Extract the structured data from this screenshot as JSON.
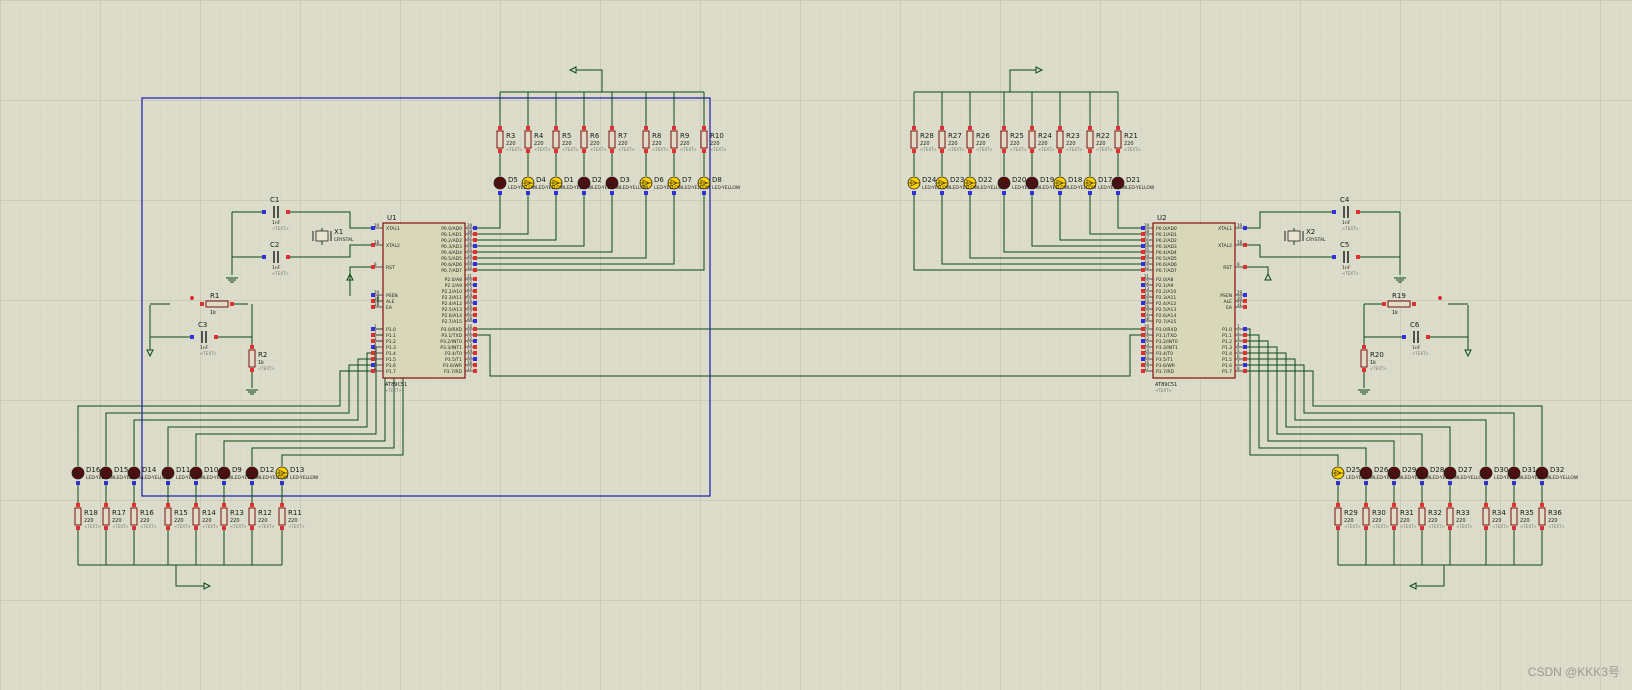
{
  "watermark": "CSDN @KKK3号",
  "colors": {
    "background": "#dcdccb",
    "grid_minor": "#cfcfbc",
    "grid_major": "#c0c0ac",
    "wire": "#0a4a14",
    "frame": "#1a1ab0",
    "chip_fill": "#d8d8b8",
    "chip_stroke": "#8a0a0a",
    "led_off": "#5a0a0a",
    "led_on": "#ffd200",
    "pin_red": "#e03030",
    "pin_blue": "#3030e0"
  },
  "u1": {
    "ref": "U1",
    "part": "AT89C51",
    "text": "<TEXT>",
    "left_pins": [
      {
        "num": "19",
        "name": "XTAL1"
      },
      {
        "num": "18",
        "name": "XTAL2"
      },
      {
        "num": "9",
        "name": "RST"
      },
      {
        "num": "29",
        "name": "PSEN"
      },
      {
        "num": "30",
        "name": "ALE"
      },
      {
        "num": "31",
        "name": "EA"
      },
      {
        "num": "1",
        "name": "P1.0"
      },
      {
        "num": "2",
        "name": "P1.1"
      },
      {
        "num": "3",
        "name": "P1.2"
      },
      {
        "num": "4",
        "name": "P1.3"
      },
      {
        "num": "5",
        "name": "P1.4"
      },
      {
        "num": "6",
        "name": "P1.5"
      },
      {
        "num": "7",
        "name": "P1.6"
      },
      {
        "num": "8",
        "name": "P1.7"
      }
    ],
    "right_pins": [
      {
        "num": "39",
        "name": "P0.0/AD0"
      },
      {
        "num": "38",
        "name": "P0.1/AD1"
      },
      {
        "num": "37",
        "name": "P0.2/AD2"
      },
      {
        "num": "36",
        "name": "P0.3/AD3"
      },
      {
        "num": "35",
        "name": "P0.4/AD4"
      },
      {
        "num": "34",
        "name": "P0.5/AD5"
      },
      {
        "num": "33",
        "name": "P0.6/AD6"
      },
      {
        "num": "32",
        "name": "P0.7/AD7"
      },
      {
        "num": "21",
        "name": "P2.0/A8"
      },
      {
        "num": "22",
        "name": "P2.1/A9"
      },
      {
        "num": "23",
        "name": "P2.2/A10"
      },
      {
        "num": "24",
        "name": "P2.3/A11"
      },
      {
        "num": "25",
        "name": "P2.4/A12"
      },
      {
        "num": "26",
        "name": "P2.5/A13"
      },
      {
        "num": "27",
        "name": "P2.6/A14"
      },
      {
        "num": "28",
        "name": "P2.7/A15"
      },
      {
        "num": "10",
        "name": "P3.0/RXD"
      },
      {
        "num": "11",
        "name": "P3.1/TXD"
      },
      {
        "num": "12",
        "name": "P3.2/INT0"
      },
      {
        "num": "13",
        "name": "P3.3/INT1"
      },
      {
        "num": "14",
        "name": "P3.4/T0"
      },
      {
        "num": "15",
        "name": "P3.5/T1"
      },
      {
        "num": "16",
        "name": "P3.6/WR"
      },
      {
        "num": "17",
        "name": "P3.7/RD"
      }
    ]
  },
  "u2": {
    "ref": "U2",
    "part": "AT89C51",
    "text": "<TEXT>"
  },
  "passives": {
    "c1": {
      "ref": "C1",
      "val": "1nF"
    },
    "c2": {
      "ref": "C2",
      "val": "1nF"
    },
    "c3": {
      "ref": "C3",
      "val": "1nF"
    },
    "c4": {
      "ref": "C4",
      "val": "1nF"
    },
    "c5": {
      "ref": "C5",
      "val": "1nF"
    },
    "c6": {
      "ref": "C6",
      "val": "1nF"
    },
    "x1": {
      "ref": "X1",
      "val": "CRYSTAL"
    },
    "x2": {
      "ref": "X2",
      "val": "CRYSTAL"
    },
    "r1": {
      "ref": "R1",
      "val": "1k"
    },
    "r2": {
      "ref": "R2",
      "val": "1k"
    },
    "r19": {
      "ref": "R19",
      "val": "1k"
    },
    "r20": {
      "ref": "R20",
      "val": "1k"
    },
    "text": "<TEXT>"
  },
  "top_left_leds": [
    {
      "d": "D5",
      "r": "R3",
      "on": false
    },
    {
      "d": "D4",
      "r": "R4",
      "on": true
    },
    {
      "d": "D1",
      "r": "R5",
      "on": true
    },
    {
      "d": "D2",
      "r": "R6",
      "on": false
    },
    {
      "d": "D3",
      "r": "R7",
      "on": false
    },
    {
      "d": "D6",
      "r": "R8",
      "on": true
    },
    {
      "d": "D7",
      "r": "R9",
      "on": true
    },
    {
      "d": "D8",
      "r": "R10",
      "on": true
    }
  ],
  "top_right_leds": [
    {
      "d": "D24",
      "r": "R28",
      "on": true
    },
    {
      "d": "D23",
      "r": "R27",
      "on": true
    },
    {
      "d": "D22",
      "r": "R26",
      "on": true
    },
    {
      "d": "D20",
      "r": "R25",
      "on": false
    },
    {
      "d": "D19",
      "r": "R24",
      "on": false
    },
    {
      "d": "D18",
      "r": "R23",
      "on": true
    },
    {
      "d": "D17",
      "r": "R22",
      "on": true
    },
    {
      "d": "D21",
      "r": "R21",
      "on": false
    }
  ],
  "bottom_left_leds": [
    {
      "d": "D16",
      "r": "R18",
      "on": false
    },
    {
      "d": "D15",
      "r": "R17",
      "on": false
    },
    {
      "d": "D14",
      "r": "R16",
      "on": false
    },
    {
      "d": "D11",
      "r": "R15",
      "on": false
    },
    {
      "d": "D10",
      "r": "R14",
      "on": false
    },
    {
      "d": "D9",
      "r": "R13",
      "on": false
    },
    {
      "d": "D12",
      "r": "R12",
      "on": false
    },
    {
      "d": "D13",
      "r": "R11",
      "on": true
    }
  ],
  "bottom_right_leds": [
    {
      "d": "D25",
      "r": "R29",
      "on": true
    },
    {
      "d": "D26",
      "r": "R30",
      "on": false
    },
    {
      "d": "D29",
      "r": "R31",
      "on": false
    },
    {
      "d": "D28",
      "r": "R32",
      "on": false
    },
    {
      "d": "D27",
      "r": "R33",
      "on": false
    },
    {
      "d": "D30",
      "r": "R34",
      "on": false
    },
    {
      "d": "D31",
      "r": "R35",
      "on": false
    },
    {
      "d": "D32",
      "r": "R36",
      "on": false
    }
  ],
  "led_value": "LED-YELLOW",
  "res_value": "220",
  "res_text": "<TEXT>"
}
